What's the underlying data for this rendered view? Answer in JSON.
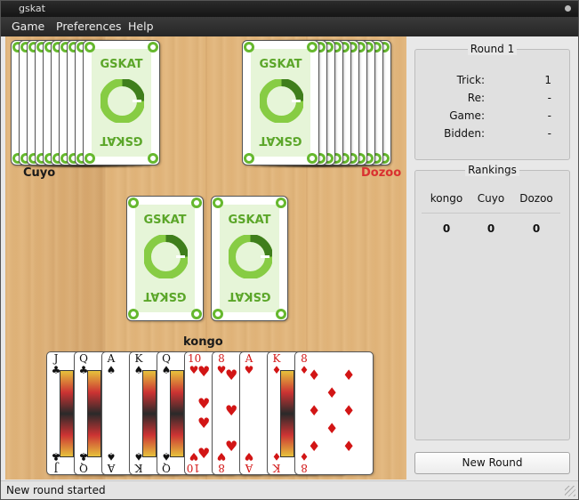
{
  "window": {
    "title": "gskat"
  },
  "menubar": {
    "items": [
      "Game",
      "Preferences",
      "Help"
    ]
  },
  "card_back": {
    "brand": "GSKAT",
    "brand_color": "#5ba629",
    "logo_dark_color": "#3f7e1c",
    "logo_light_color": "#87cc44"
  },
  "players": {
    "left": {
      "name": "Cuyo",
      "cards_in_hand": 10
    },
    "right": {
      "name": "Dozoo",
      "cards_in_hand": 10,
      "name_color": "#d93030"
    },
    "human": {
      "name": "kongo"
    }
  },
  "skat": {
    "cards": 2
  },
  "hand": [
    {
      "rank": "J",
      "suit": "♣",
      "color": "black",
      "face": true
    },
    {
      "rank": "Q",
      "suit": "♣",
      "color": "black",
      "face": true
    },
    {
      "rank": "A",
      "suit": "♠",
      "color": "black",
      "face": false
    },
    {
      "rank": "K",
      "suit": "♠",
      "color": "black",
      "face": true
    },
    {
      "rank": "Q",
      "suit": "♠",
      "color": "black",
      "face": true
    },
    {
      "rank": "10",
      "suit": "♥",
      "color": "red",
      "face": false
    },
    {
      "rank": "8",
      "suit": "♥",
      "color": "red",
      "face": false
    },
    {
      "rank": "A",
      "suit": "♥",
      "color": "red",
      "face": false
    },
    {
      "rank": "K",
      "suit": "♦",
      "color": "red",
      "face": true
    },
    {
      "rank": "8",
      "suit": "♦",
      "color": "red",
      "face": false
    }
  ],
  "round_info": {
    "title": "Round 1",
    "rows": [
      {
        "label": "Trick:",
        "value": "1"
      },
      {
        "label": "Re:",
        "value": "-"
      },
      {
        "label": "Game:",
        "value": "-"
      },
      {
        "label": "Bidden:",
        "value": "-"
      }
    ]
  },
  "rankings": {
    "title": "Rankings",
    "columns": [
      "kongo",
      "Cuyo",
      "Dozoo"
    ],
    "scores": [
      "0",
      "0",
      "0"
    ]
  },
  "new_round_label": "New Round",
  "status": {
    "text": "New round started"
  }
}
